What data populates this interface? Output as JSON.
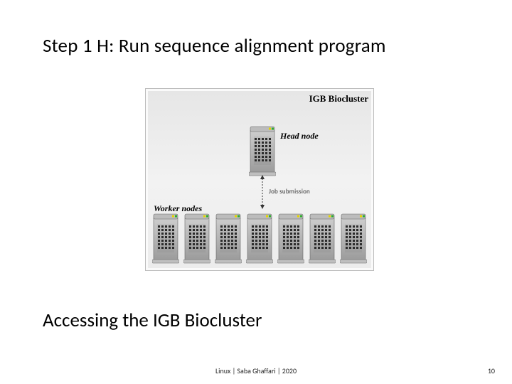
{
  "title": "Step 1 H: Run sequence alignment program",
  "subtitle": "Accessing the IGB Biocluster",
  "diagram": {
    "cluster_title": "IGB Biocluster",
    "head_node_label": "Head node",
    "arrow_label": "Job submission",
    "worker_nodes_label": "Worker nodes",
    "worker_count": 7
  },
  "footer": {
    "center": "Linux | Saba Ghaffari | 2020",
    "page": "10"
  }
}
